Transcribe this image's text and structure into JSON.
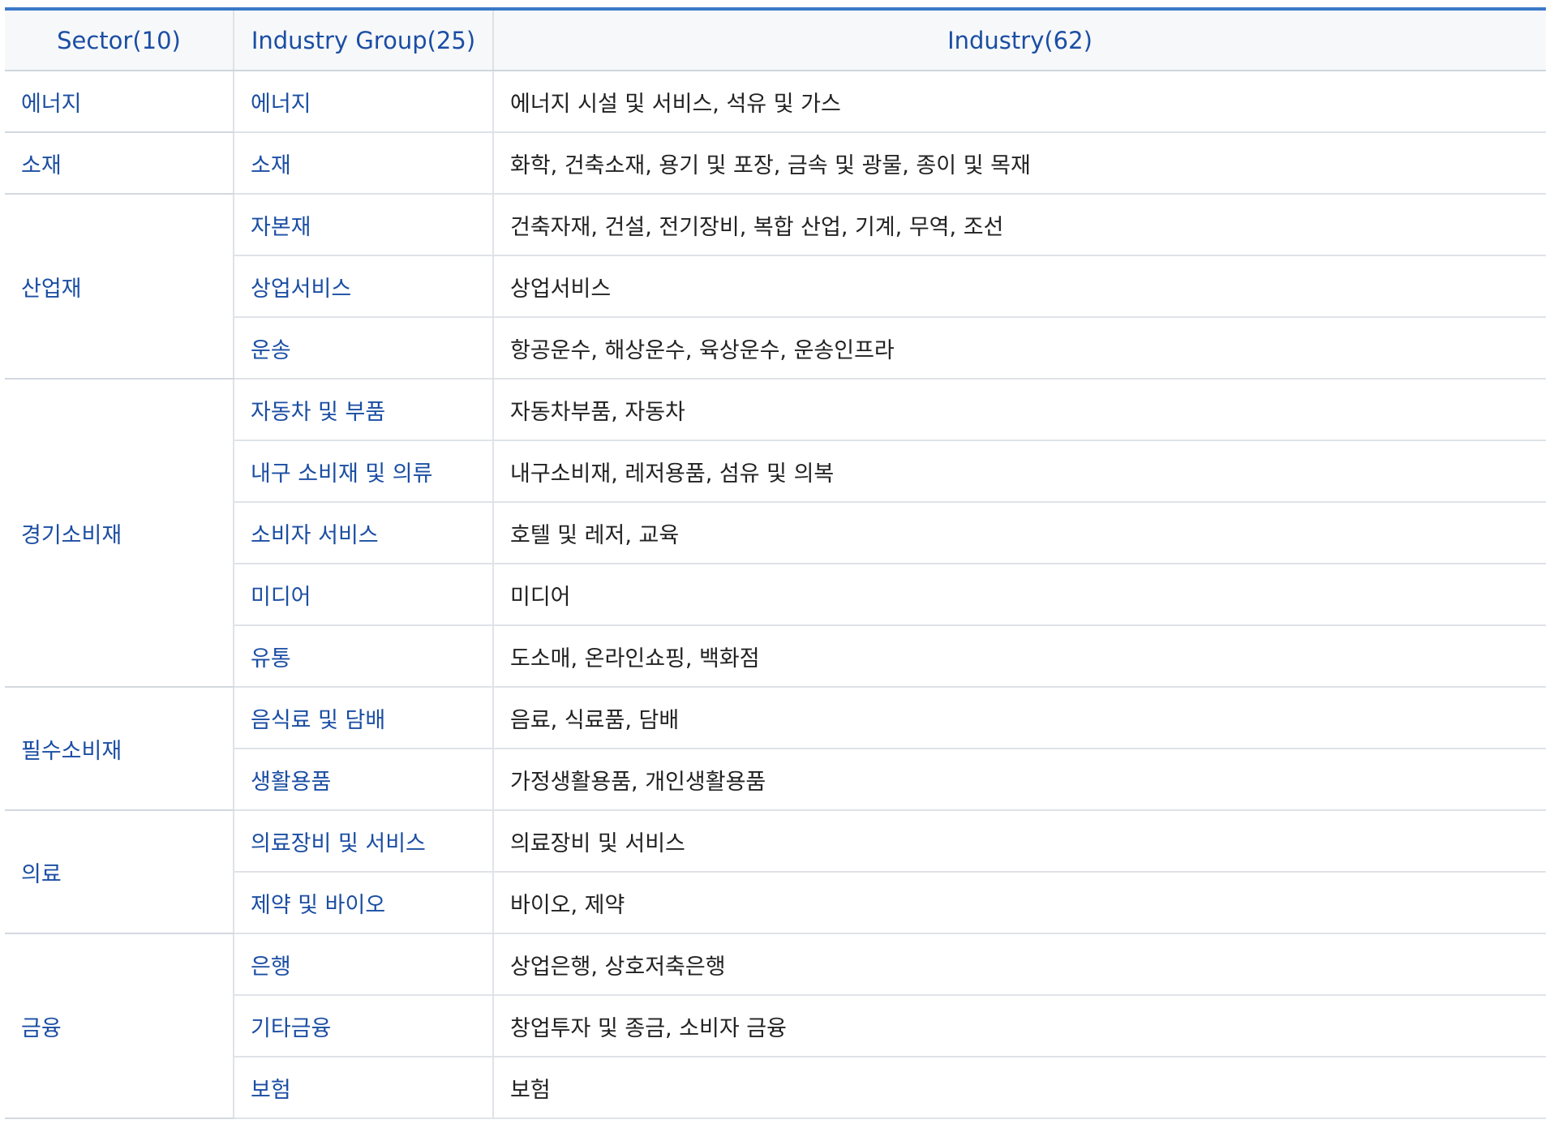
{
  "headers": {
    "sector": "Sector(10)",
    "group": "Industry Group(25)",
    "industry": "Industry(62)"
  },
  "rows": [
    {
      "sector": "에너지",
      "group": "에너지",
      "industry": "에너지 시설 및 서비스, 석유 및 가스"
    },
    {
      "sector": "소재",
      "group": "소재",
      "industry": "화학, 건축소재, 용기 및 포장, 금속 및 광물, 종이 및 목재"
    },
    {
      "sector": "산업재",
      "group": "자본재",
      "industry": "건축자재, 건설, 전기장비, 복합 산업, 기계, 무역, 조선"
    },
    {
      "group": "상업서비스",
      "industry": "상업서비스"
    },
    {
      "group": "운송",
      "industry": "항공운수, 해상운수, 육상운수, 운송인프라"
    },
    {
      "sector": "경기소비재",
      "group": "자동차 및 부품",
      "industry": "자동차부품, 자동차"
    },
    {
      "group": "내구 소비재 및 의류",
      "industry": "내구소비재, 레저용품, 섬유 및 의복"
    },
    {
      "group": "소비자 서비스",
      "industry": "호텔 및 레저, 교육"
    },
    {
      "group": "미디어",
      "industry": "미디어"
    },
    {
      "group": "유통",
      "industry": "도소매, 온라인쇼핑, 백화점"
    },
    {
      "sector": "필수소비재",
      "group": "음식료 및 담배",
      "industry": "음료, 식료품, 담배"
    },
    {
      "group": "생활용품",
      "industry": "가정생활용품, 개인생활용품"
    },
    {
      "sector": "의료",
      "group": "의료장비 및 서비스",
      "industry": "의료장비 및 서비스"
    },
    {
      "group": "제약 및 바이오",
      "industry": "바이오, 제약"
    },
    {
      "sector": "금융",
      "group": "은행",
      "industry": "상업은행, 상호저축은행"
    },
    {
      "group": "기타금융",
      "industry": "창업투자 및 종금, 소비자 금융"
    },
    {
      "group": "보험",
      "industry": "보험"
    }
  ]
}
